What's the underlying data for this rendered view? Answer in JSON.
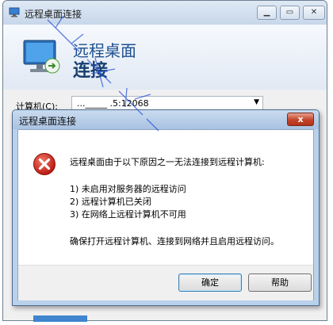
{
  "background_window": {
    "title": "远程桌面连接",
    "caption_buttons": {
      "minimize": "▭",
      "maximize": "▭",
      "close": "✕"
    },
    "banner": {
      "line1": "远程桌面",
      "line2": "连接"
    },
    "computer_label": "计算机(C):",
    "computer_value": "..._____  .5:12068"
  },
  "dialog": {
    "title": "远程桌面连接",
    "close_label": "x",
    "message": "远程桌面由于以下原因之一无法连接到远程计算机:",
    "reasons": [
      "1) 未启用对服务器的远程访问",
      "2) 远程计算机已关闭",
      "3) 在网络上远程计算机不可用"
    ],
    "ensure_text": "确保打开远程计算机、连接到网络并且启用远程访问。",
    "buttons": {
      "ok": "确定",
      "help": "帮助"
    }
  },
  "colors": {
    "dialog_frame": "#b9d1ea",
    "close_button": "#c4432a",
    "error_icon": "#c8201c",
    "watermark": "#2a55d8"
  },
  "icons": [
    "rdp-app-icon",
    "monitor-icon",
    "error-icon",
    "dropdown-arrow-icon"
  ]
}
